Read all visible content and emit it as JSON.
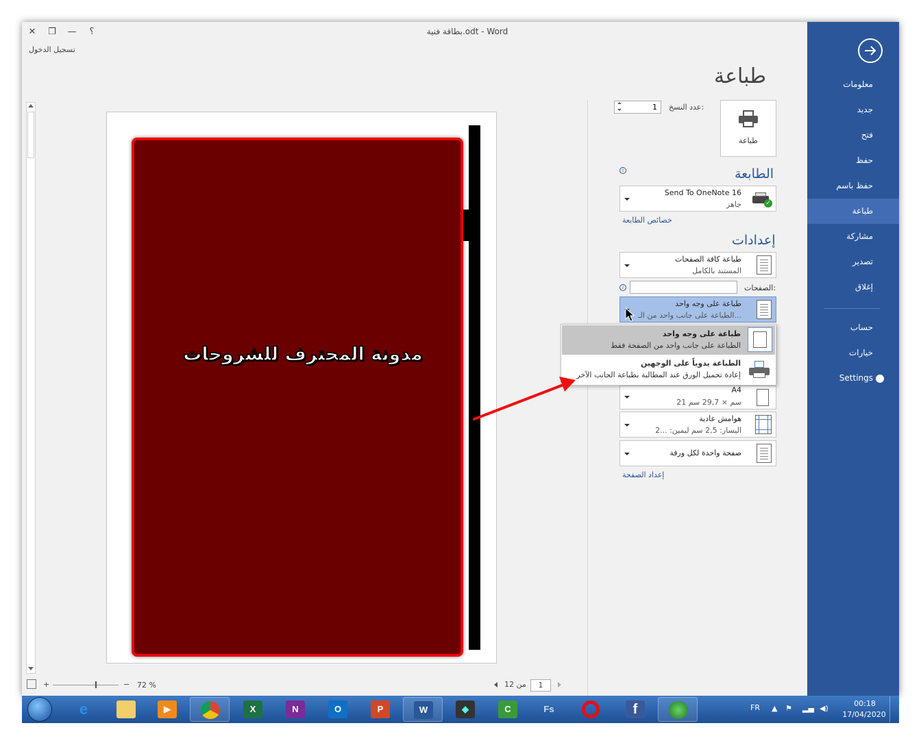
{
  "window": {
    "title": "بطاقة فنية.odt - Word",
    "signin": "تسجيل الدخول",
    "help": "؟",
    "minimize": "—",
    "restore": "❐",
    "close": "✕"
  },
  "nav": {
    "items": [
      {
        "label": "معلومات"
      },
      {
        "label": "جديد"
      },
      {
        "label": "فتح"
      },
      {
        "label": "حفظ"
      },
      {
        "label": "حفظ باسم"
      },
      {
        "label": "طباعة"
      },
      {
        "label": "مشاركة"
      },
      {
        "label": "تصدير"
      },
      {
        "label": "إغلاق"
      },
      {
        "label": "حساب"
      },
      {
        "label": "خيارات"
      },
      {
        "label": "Settings"
      }
    ],
    "active": "طباعة",
    "accent": "#2b579a"
  },
  "print": {
    "heading": "طباعة",
    "button_label": "طباعة",
    "copies_label": "عدد النسخ:",
    "copies_value": "1",
    "printer_heading": "الطابعة",
    "printer_name": "Send To OneNote 16",
    "printer_status": "جاهز",
    "printer_properties": "خصائص الطابعة",
    "settings_heading": "إعدادات",
    "pages_label": "الصفحات:",
    "page_setup": "إعداد الصفحة",
    "settings": {
      "range_main": "طباعة كافة الصفحات",
      "range_sub": "المستند بالكامل",
      "sides_main": "طباعة على وجه واحد",
      "sides_sub": "الطباعة على جانب واحد من الـ...",
      "paper_main": "A4",
      "paper_sub": "21 سم × 29,7 سم",
      "margins_main": "هوامش عادية",
      "margins_sub": "اليسار:  2,5 سم    ليمين:  ...2",
      "perpage_main": "صفحة واحدة لكل ورقة"
    },
    "popup": [
      {
        "title": "طباعة على وجه واحد",
        "desc": "الطباعة على جانب واحد من الصفحة فقط"
      },
      {
        "title": "الطباعة يدوياً على الوجهين",
        "desc": "إعادة تحميل الورق عند المطالبة بطباعة الجانب الآخر"
      }
    ]
  },
  "preview": {
    "card_text": "مدونة المحترف للشروحات",
    "card_color": "#6b0000",
    "border_color": "#f00000"
  },
  "footer": {
    "page_current": "1",
    "page_of": "من 12",
    "zoom": "72 %"
  },
  "taskbar": {
    "apps": [
      {
        "name": "internet-explorer-icon",
        "glyph": "e"
      },
      {
        "name": "file-explorer-icon",
        "glyph": ""
      },
      {
        "name": "media-player-icon",
        "glyph": "▶"
      },
      {
        "name": "chrome-icon",
        "glyph": ""
      },
      {
        "name": "excel-icon",
        "glyph": "X"
      },
      {
        "name": "onenote-icon",
        "glyph": "N"
      },
      {
        "name": "outlook-icon",
        "glyph": "O"
      },
      {
        "name": "powerpoint-icon",
        "glyph": "P"
      },
      {
        "name": "word-icon",
        "glyph": "W"
      },
      {
        "name": "filmora-icon",
        "glyph": "◆"
      },
      {
        "name": "camtasia-icon",
        "glyph": "C"
      },
      {
        "name": "fs-icon",
        "glyph": "Fs"
      },
      {
        "name": "opera-icon",
        "glyph": "O"
      },
      {
        "name": "facebook-icon",
        "glyph": "f"
      },
      {
        "name": "network-app-icon",
        "glyph": ""
      }
    ],
    "language": "FR",
    "time": "00:18",
    "date": "17/04/2020"
  }
}
